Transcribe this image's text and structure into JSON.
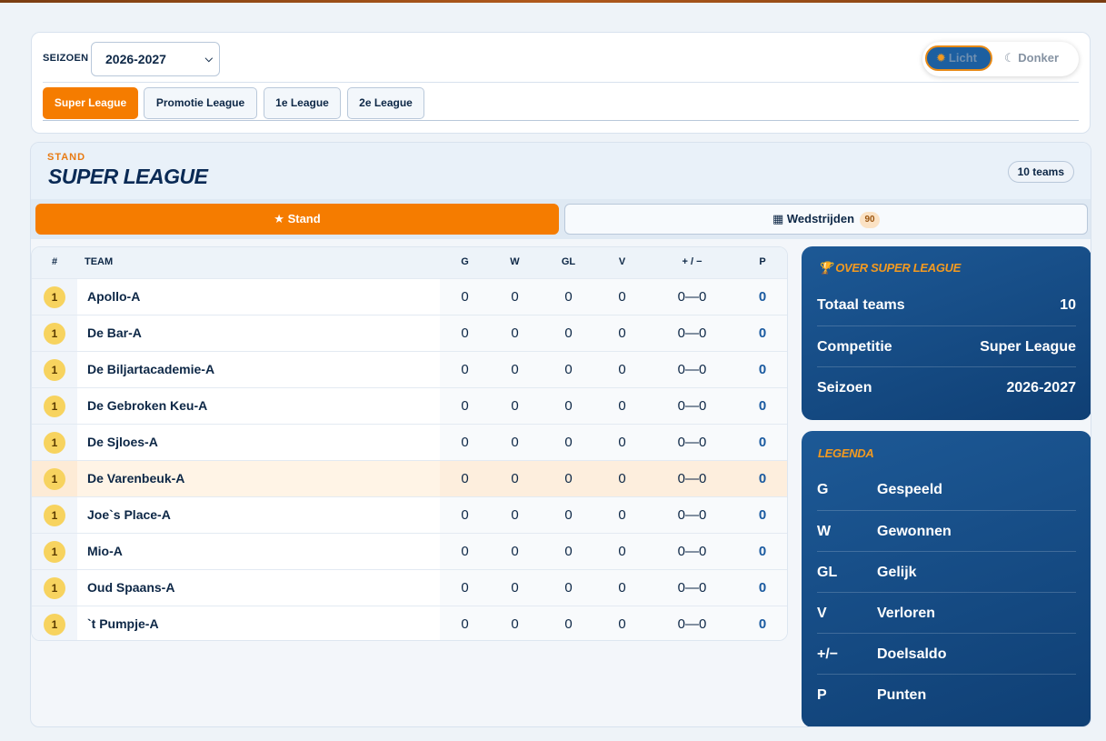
{
  "filters": {
    "season_label": "SEIZOEN",
    "season_value": "2026-2027",
    "theme": {
      "light_label": "Licht",
      "dark_label": "Donker",
      "active": "light"
    },
    "league_tabs": [
      {
        "label": "Super League",
        "active": true
      },
      {
        "label": "Promotie League",
        "active": false
      },
      {
        "label": "1e League",
        "active": false
      },
      {
        "label": "2e League",
        "active": false
      }
    ]
  },
  "header": {
    "eyebrow": "STAND",
    "title": "SUPER LEAGUE",
    "teams_badge": "10 teams"
  },
  "view_tabs": {
    "stand_label": "Stand",
    "matches_label": "Wedstrijden",
    "matches_count": "90"
  },
  "table": {
    "columns": {
      "rank": "#",
      "team": "TEAM",
      "g": "G",
      "w": "W",
      "gl": "GL",
      "v": "V",
      "diff": "+ / −",
      "p": "P"
    },
    "rows": [
      {
        "rank": "1",
        "team": "Apollo-A",
        "g": "0",
        "w": "0",
        "gl": "0",
        "v": "0",
        "diff": "0—0",
        "p": "0"
      },
      {
        "rank": "1",
        "team": "De Bar-A",
        "g": "0",
        "w": "0",
        "gl": "0",
        "v": "0",
        "diff": "0—0",
        "p": "0"
      },
      {
        "rank": "1",
        "team": "De Biljartacademie-A",
        "g": "0",
        "w": "0",
        "gl": "0",
        "v": "0",
        "diff": "0—0",
        "p": "0"
      },
      {
        "rank": "1",
        "team": "De Gebroken Keu-A",
        "g": "0",
        "w": "0",
        "gl": "0",
        "v": "0",
        "diff": "0—0",
        "p": "0"
      },
      {
        "rank": "1",
        "team": "De Sjloes-A",
        "g": "0",
        "w": "0",
        "gl": "0",
        "v": "0",
        "diff": "0—0",
        "p": "0"
      },
      {
        "rank": "1",
        "team": "De Varenbeuk-A",
        "g": "0",
        "w": "0",
        "gl": "0",
        "v": "0",
        "diff": "0—0",
        "p": "0",
        "highlighted": true
      },
      {
        "rank": "1",
        "team": "Joe`s Place-A",
        "g": "0",
        "w": "0",
        "gl": "0",
        "v": "0",
        "diff": "0—0",
        "p": "0"
      },
      {
        "rank": "1",
        "team": "Mio-A",
        "g": "0",
        "w": "0",
        "gl": "0",
        "v": "0",
        "diff": "0—0",
        "p": "0"
      },
      {
        "rank": "1",
        "team": "Oud Spaans-A",
        "g": "0",
        "w": "0",
        "gl": "0",
        "v": "0",
        "diff": "0—0",
        "p": "0"
      },
      {
        "rank": "1",
        "team": "`t Pumpje-A",
        "g": "0",
        "w": "0",
        "gl": "0",
        "v": "0",
        "diff": "0—0",
        "p": "0"
      }
    ]
  },
  "about": {
    "title": "OVER SUPER LEAGUE",
    "items": [
      {
        "label": "Totaal teams",
        "value": "10"
      },
      {
        "label": "Competitie",
        "value": "Super League"
      },
      {
        "label": "Seizoen",
        "value": "2026-2027"
      }
    ]
  },
  "legend": {
    "title": "LEGENDA",
    "items": [
      {
        "abbr": "G",
        "desc": "Gespeeld"
      },
      {
        "abbr": "W",
        "desc": "Gewonnen"
      },
      {
        "abbr": "GL",
        "desc": "Gelijk"
      },
      {
        "abbr": "V",
        "desc": "Verloren"
      },
      {
        "abbr": "+/−",
        "desc": "Doelsaldo"
      },
      {
        "abbr": "P",
        "desc": "Punten"
      }
    ]
  },
  "colors": {
    "accent": "#f57c00",
    "navy": "#0d2746",
    "panel": "#15508c",
    "rank_badge": "#f7d35f"
  }
}
